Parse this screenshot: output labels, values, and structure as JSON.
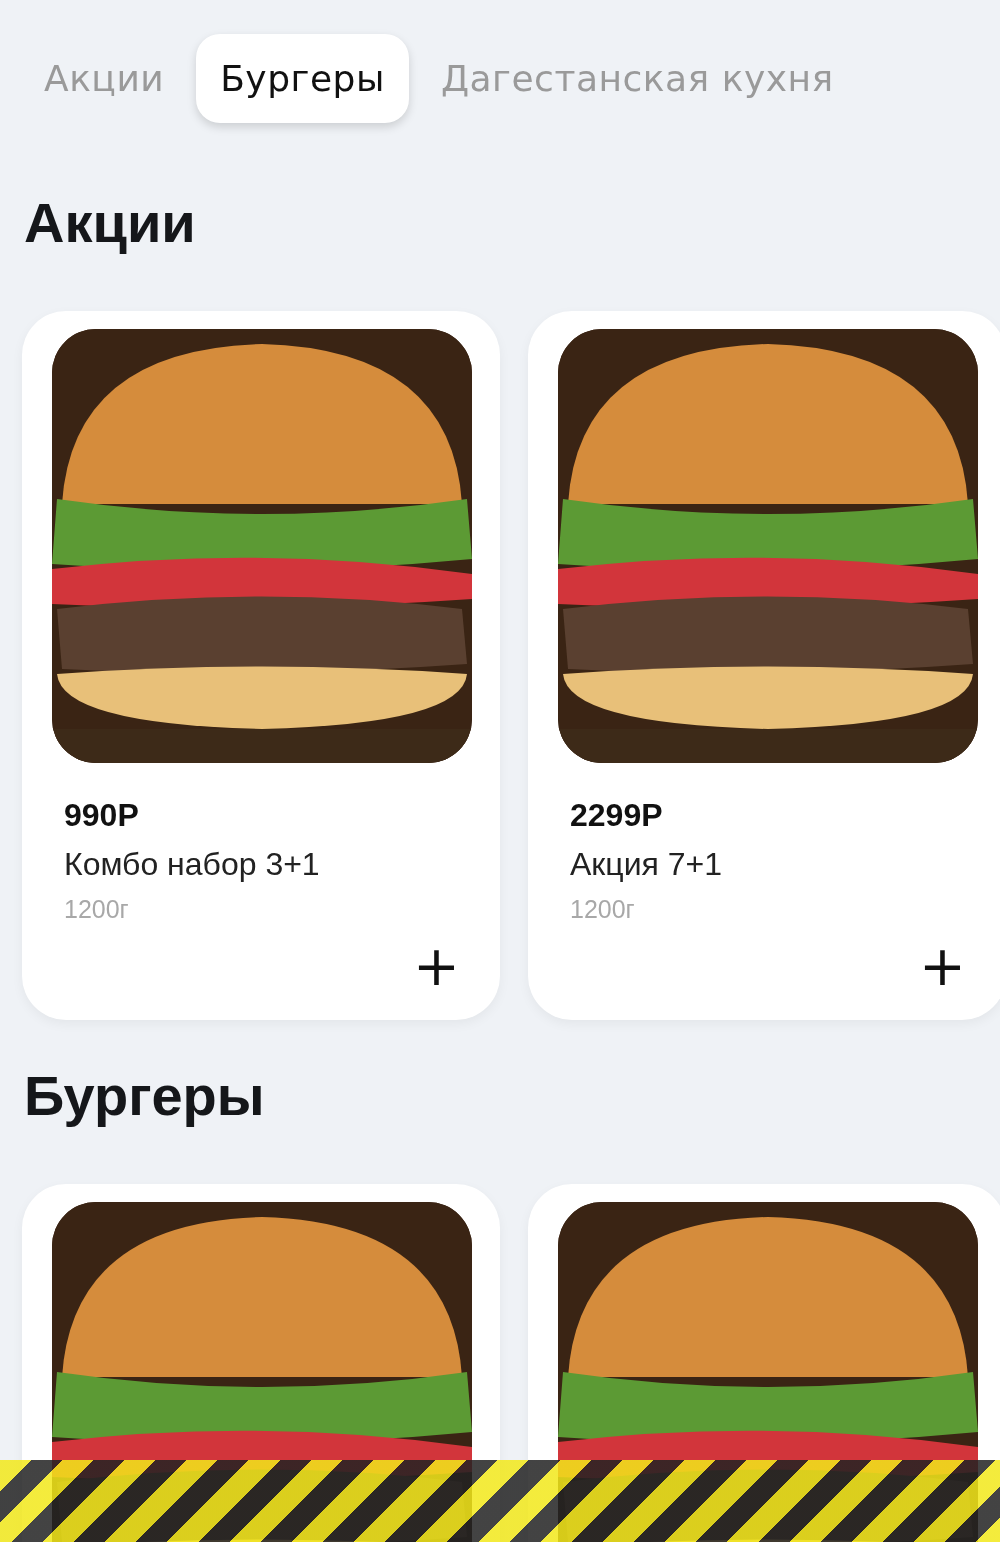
{
  "tabs": [
    {
      "label": "Акции",
      "selected": false
    },
    {
      "label": "Бургеры",
      "selected": true
    },
    {
      "label": "Дагестанская кухня",
      "selected": false
    }
  ],
  "sections": [
    {
      "title": "Акции",
      "products": [
        {
          "photo": true,
          "price": "990Р",
          "name": "Комбо набор 3+1",
          "weight": "1200г",
          "add": "+"
        },
        {
          "photo": true,
          "price": "2299Р",
          "name": "Акция 7+1",
          "weight": "1200г",
          "add": "+"
        }
      ]
    },
    {
      "title": "Бургеры",
      "products": [
        {
          "photo": true
        },
        {
          "photo": true
        }
      ]
    }
  ]
}
